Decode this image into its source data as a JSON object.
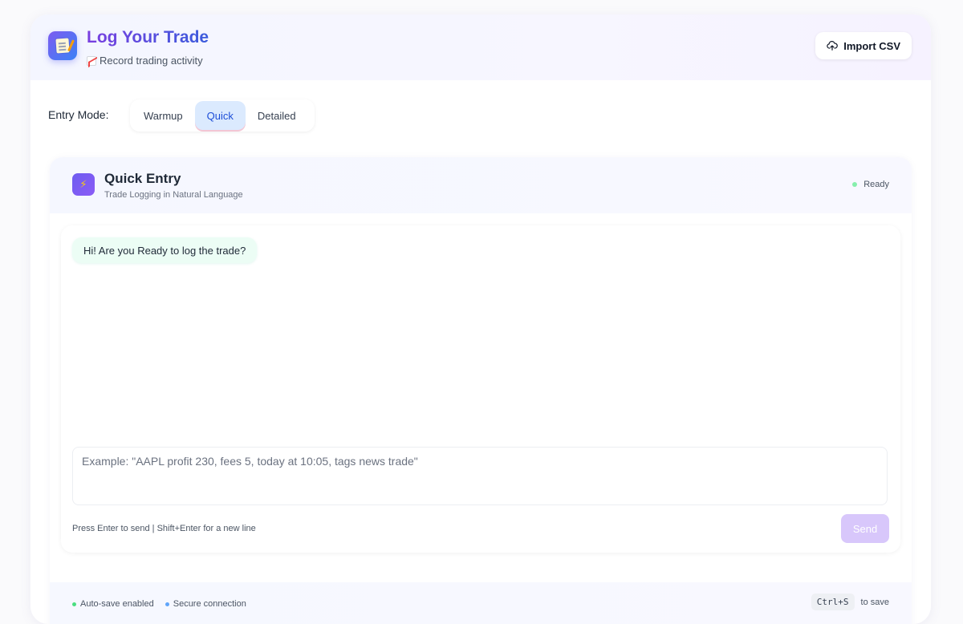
{
  "header": {
    "title": "Log Your Trade",
    "subtitle": "Record trading activity",
    "app_icon": "memo-icon",
    "subtitle_icon": "chart-increasing-icon",
    "import_button": {
      "label": "Import CSV",
      "icon": "cloud-upload-icon"
    }
  },
  "entry_mode": {
    "label": "Entry Mode:",
    "options": [
      "Warmup",
      "Quick",
      "Detailed"
    ],
    "selected": "Quick"
  },
  "quick_entry": {
    "title": "Quick Entry",
    "subtitle": "Trade Logging in Natural Language",
    "icon": "lightning-icon",
    "status": "Ready",
    "status_color": "#86efac"
  },
  "chat": {
    "greeting": "Hi! Are you Ready to log the trade?",
    "input_placeholder": "Example: \"AAPL profit 230, fees 5, today at 10:05, tags news trade\"",
    "hint": "Press Enter to send | Shift+Enter for a new line",
    "send_label": "Send"
  },
  "footer": {
    "autosave": "Auto-save enabled",
    "secure": "Secure connection",
    "shortcut_key": "Ctrl+S",
    "shortcut_action": "to save"
  },
  "colors": {
    "accent_purple": "#7a3fe0",
    "accent_blue": "#3a5bdc",
    "active_mode_bg": "#dbeafe",
    "send_button": "#d8c7fb",
    "greeting_bubble": "#ecfdf5"
  }
}
